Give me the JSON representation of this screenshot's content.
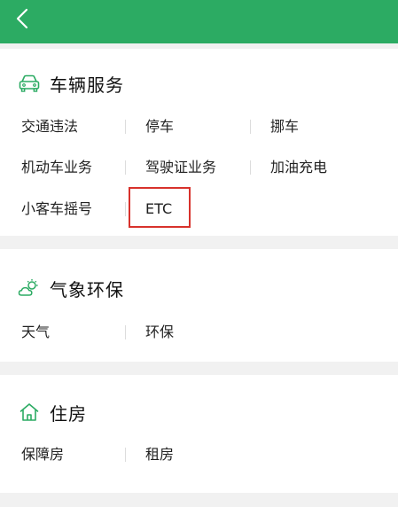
{
  "colors": {
    "header": "#2cab63",
    "accent_icon": "#2cab63",
    "highlight": "#d8322c"
  },
  "header": {
    "back_icon": "chevron-left-icon"
  },
  "sections": {
    "vehicle": {
      "title": "车辆服务",
      "icon": "car-icon",
      "items": [
        "交通违法",
        "停车",
        "挪车",
        "机动车业务",
        "驾驶证业务",
        "加油充电",
        "小客车摇号",
        "ETC"
      ]
    },
    "weather": {
      "title": "气象环保",
      "icon": "sun-cloud-icon",
      "items": [
        "天气",
        "环保"
      ]
    },
    "housing": {
      "title": "住房",
      "icon": "house-icon",
      "items": [
        "保障房",
        "租房"
      ]
    }
  }
}
